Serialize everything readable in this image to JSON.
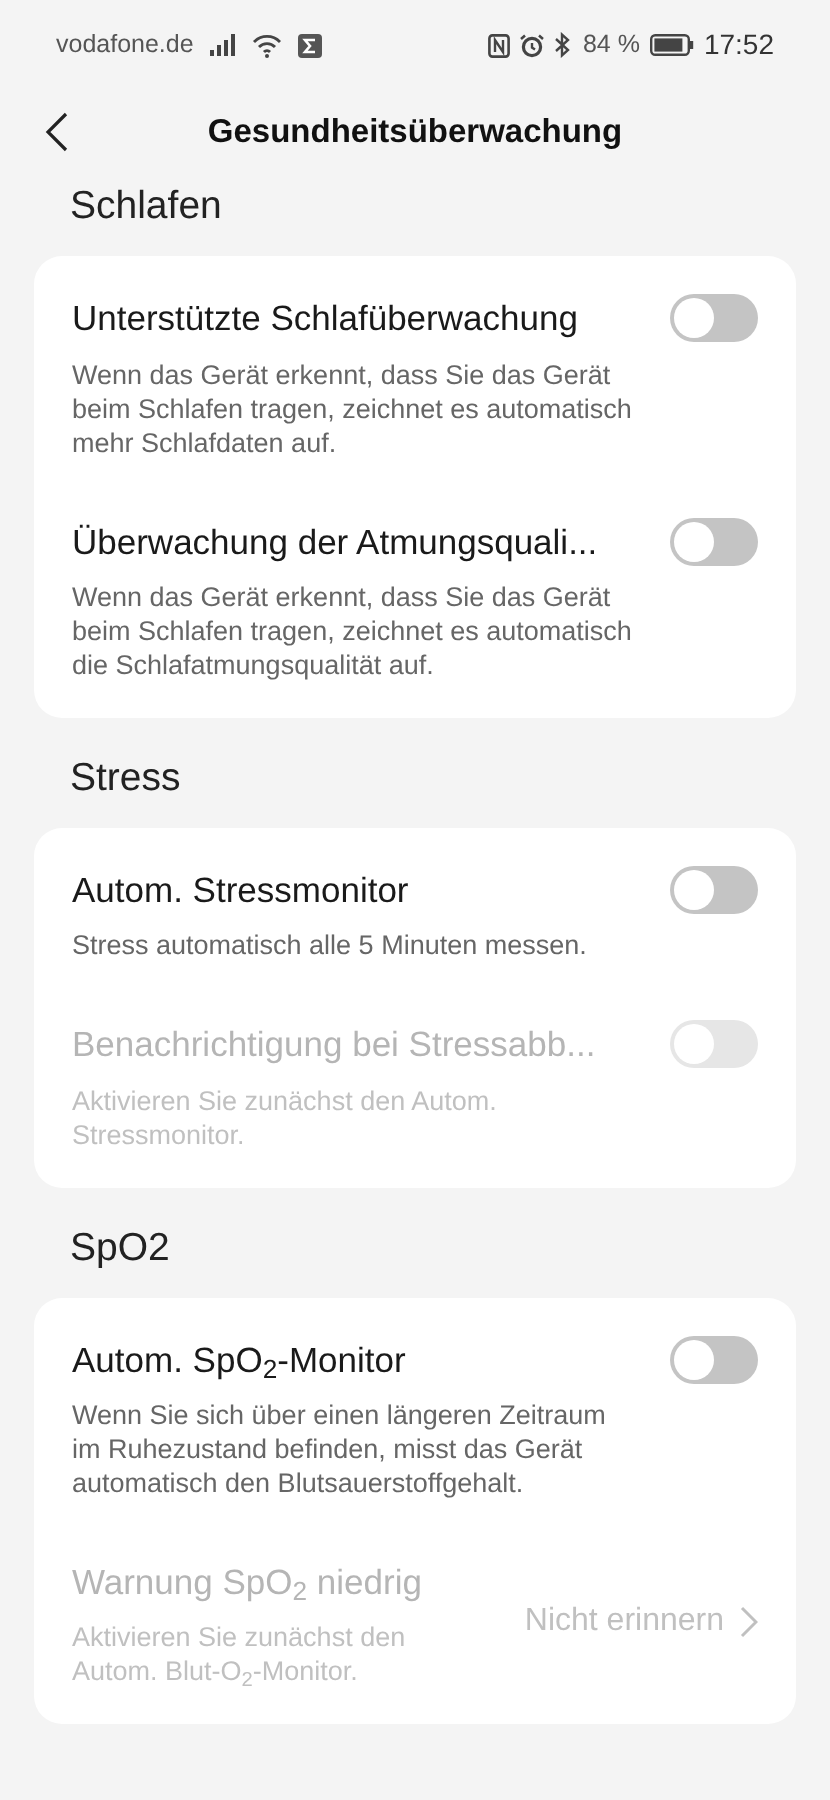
{
  "status_bar": {
    "carrier": "vodafone.de",
    "battery": "84 %",
    "time": "17:52"
  },
  "header": {
    "title": "Gesundheitsüberwachung"
  },
  "sections": [
    {
      "title": "Schlafen",
      "items": [
        {
          "kind": "toggle",
          "title": "Unterstützte Schlafüberwachung",
          "description": "Wenn das Gerät erkennt, dass Sie das Gerät beim Schlafen tragen, zeichnet es automatisch mehr Schlafdaten auf.",
          "on": false,
          "disabled": false
        },
        {
          "kind": "toggle",
          "title": "Überwachung der Atmungsquali...",
          "description": "Wenn das Gerät erkennt, dass Sie das Gerät beim Schlafen tragen, zeichnet es automatisch die Schlafatmungsqualität auf.",
          "on": false,
          "disabled": false
        }
      ]
    },
    {
      "title": "Stress",
      "items": [
        {
          "kind": "toggle",
          "title": "Autom. Stressmonitor",
          "description": "Stress automatisch alle 5 Minuten messen.",
          "on": false,
          "disabled": false
        },
        {
          "kind": "toggle",
          "title": "Benachrichtigung bei Stressabb...",
          "description": "Aktivieren Sie zunächst den Autom. Stressmonitor.",
          "on": false,
          "disabled": true
        }
      ]
    },
    {
      "title": "SpO2",
      "items": [
        {
          "kind": "toggle",
          "title": "Autom. SpO$_{2}$-Monitor",
          "description": "Wenn Sie sich über einen längeren Zeitraum im Ruhezustand befinden, misst das Gerät automatisch den Blutsauerstoffgehalt.",
          "on": false,
          "disabled": false
        },
        {
          "kind": "value",
          "title": "Warnung SpO$_{2}$ niedrig",
          "description": "Aktivieren Sie zunächst den Autom. Blut-O$_{2}$-Monitor.",
          "value": "Nicht erinnern",
          "disabled": true
        }
      ]
    }
  ]
}
